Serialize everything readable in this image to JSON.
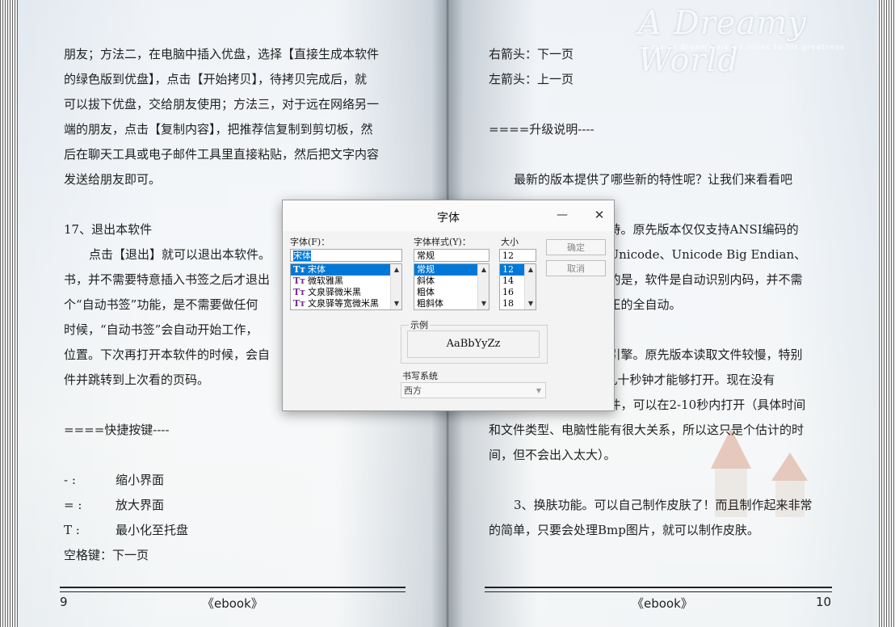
{
  "book": {
    "watermark_title": "A Dreamy World",
    "watermark_subtitle": "a man's dreams are an index to his greatness",
    "left_page": {
      "lines": [
        {
          "text": "朋友；方法二，在电脑中插入优盘，选择【直接生成本软件",
          "indent": false
        },
        {
          "text": "的绿色版到优盘】，点击【开始拷贝】，待拷贝完成后，就",
          "indent": false
        },
        {
          "text": "可以拔下优盘，交给朋友使用；方法三，对于远在网络另一",
          "indent": false
        },
        {
          "text": "端的朋友，点击【复制内容】，把推荐信复制到剪切板，然",
          "indent": false
        },
        {
          "text": "后在聊天工具或电子邮件工具里直接粘贴，然后把文字内容",
          "indent": false
        },
        {
          "text": "发送给朋友即可。",
          "indent": false
        },
        {
          "text": "",
          "indent": false
        },
        {
          "text": "17、退出本软件",
          "indent": false
        },
        {
          "text": "点击【退出】就可以退出本软件。",
          "indent": true
        },
        {
          "text": "书，并不需要特意插入书签之后才退出",
          "indent": false
        },
        {
          "text": "个“自动书签”功能，是不需要做任何",
          "indent": false
        },
        {
          "text": "时候，“自动书签”会自动开始工作，",
          "indent": false
        },
        {
          "text": "位置。下次再打开本软件的时候，会自",
          "indent": false
        },
        {
          "text": "件并跳转到上次看的页码。",
          "indent": false
        },
        {
          "text": "",
          "indent": false
        },
        {
          "text": "====快捷按键----",
          "indent": false
        },
        {
          "text": "",
          "indent": false
        }
      ],
      "shortcuts": [
        {
          "key": "- :",
          "desc": "缩小界面"
        },
        {
          "key": "= :",
          "desc": "放大界面"
        },
        {
          "key": "T :",
          "desc": "最小化至托盘"
        }
      ],
      "last_line": "空格键：下一页",
      "page_number": "9",
      "footer_title": "《ebook》"
    },
    "right_page": {
      "lines": [
        {
          "text": "右箭头：下一页",
          "indent": false
        },
        {
          "text": "左箭头：上一页",
          "indent": false
        },
        {
          "text": "",
          "indent": false
        },
        {
          "text": "====升级说明----",
          "indent": false
        },
        {
          "text": "",
          "indent": false
        },
        {
          "text": "最新的版本提供了哪些新的特性呢？让我们来看看吧",
          "indent": true
        },
        {
          "text": "",
          "indent": false
        },
        {
          "text": "                            支持。原先版本仅仅支持ANSI编码的",
          "indent": false
        },
        {
          "text": "                            持Unicode、Unicode Big Endian、",
          "indent": false
        },
        {
          "text": "                            出的是，软件是自动识别内码，并不需",
          "indent": false
        },
        {
          "text": "                            真正的全自动。",
          "indent": false
        },
        {
          "text": "",
          "indent": false
        },
        {
          "text": "                            取引擎。原先版本读取文件较慢，特别",
          "indent": false
        },
        {
          "text": "                        需要几十秒钟才能够打开。现在没有",
          "indent": false
        },
        {
          "text": "                            文件，可以在2-10秒内打开（具体时间",
          "indent": false
        },
        {
          "text": "和文件类型、电脑性能有很大关系，所以这只是个估计的时",
          "indent": false
        },
        {
          "text": "间，但不会出入太大）。",
          "indent": false
        },
        {
          "text": "",
          "indent": false
        },
        {
          "text": "3、换肤功能。可以自己制作皮肤了！而且制作起来非常",
          "indent": true
        },
        {
          "text": "的简单，只要会处理Bmp图片，就可以制作皮肤。",
          "indent": false
        }
      ],
      "page_number": "10",
      "footer_title": "《ebook》"
    }
  },
  "dialog": {
    "title": "字体",
    "minimize_glyph": "—",
    "close_glyph": "✕",
    "font_label": "字体(F)：",
    "font_value": "宋体",
    "font_items": [
      "宋体",
      "微软雅黑",
      "文泉驿微米黑",
      "文泉驿等宽微米黑"
    ],
    "style_label": "字体样式(Y)：",
    "style_value": "常规",
    "style_items": [
      "常规",
      "斜体",
      "粗体",
      "粗斜体"
    ],
    "size_label": "大小",
    "size_value": "12",
    "size_items": [
      "12",
      "14",
      "16",
      "18"
    ],
    "ok_label": "确定",
    "cancel_label": "取消",
    "sample_label": "示例",
    "sample_text": "AaBbYyZz",
    "script_label": "书写系统",
    "script_value": "西方"
  }
}
